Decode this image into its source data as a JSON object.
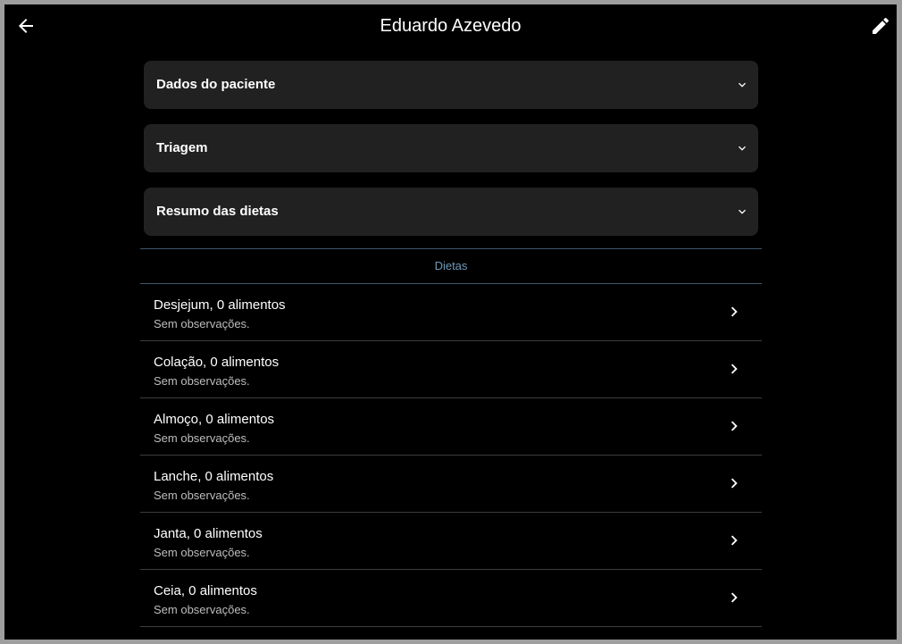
{
  "appbar": {
    "title": "Eduardo Azevedo",
    "back_icon": "arrow-left-icon",
    "edit_icon": "pencil-icon"
  },
  "panels": [
    {
      "label": "Dados do paciente"
    },
    {
      "label": "Triagem"
    },
    {
      "label": "Resumo das dietas"
    }
  ],
  "section": {
    "title": "Dietas"
  },
  "diets": [
    {
      "title": "Desjejum, 0 alimentos",
      "subtitle": "Sem observações."
    },
    {
      "title": "Colação, 0 alimentos",
      "subtitle": "Sem observações."
    },
    {
      "title": "Almoço, 0 alimentos",
      "subtitle": "Sem observações."
    },
    {
      "title": "Lanche, 0 alimentos",
      "subtitle": "Sem observações."
    },
    {
      "title": "Janta, 0 alimentos",
      "subtitle": "Sem observações."
    },
    {
      "title": "Ceia, 0 alimentos",
      "subtitle": "Sem observações."
    }
  ],
  "colors": {
    "background": "#000000",
    "panel": "#212121",
    "accent": "#6f9ab8",
    "text": "#ffffff",
    "muted_text": "#bdbdbd"
  }
}
